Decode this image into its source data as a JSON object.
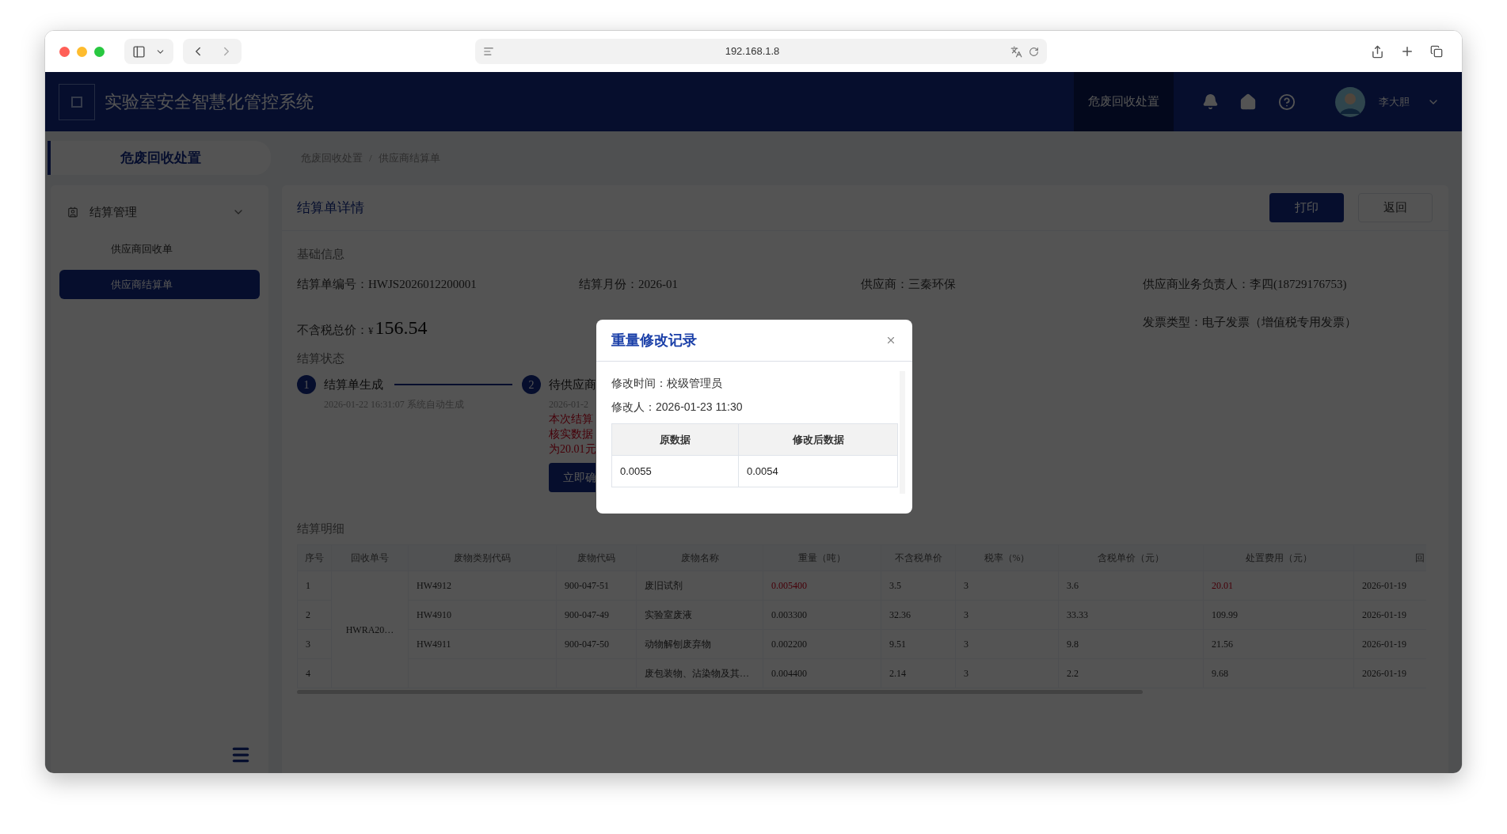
{
  "browser": {
    "url": "192.168.1.8"
  },
  "app": {
    "title": "实验室安全智慧化管控系统",
    "nav": [
      {
        "label": "危废回收处置",
        "selected": true
      }
    ],
    "user": {
      "name": "李大胆"
    }
  },
  "sidebar": {
    "section_title": "危废回收处置",
    "groups": [
      {
        "label": "结算管理",
        "expanded": true,
        "children": [
          {
            "label": "供应商回收单",
            "selected": false
          },
          {
            "label": "供应商结算单",
            "selected": true
          }
        ]
      }
    ]
  },
  "breadcrumb": {
    "items": [
      "危废回收处置",
      "供应商结算单"
    ],
    "separator": "/"
  },
  "card": {
    "title": "结算单详情",
    "buttons": [
      {
        "label": "打印",
        "kind": "primary"
      },
      {
        "label": "返回",
        "kind": "default"
      }
    ],
    "basic_info": {
      "heading": "基础信息",
      "fields": [
        {
          "label": "结算单编号：",
          "value": "HWJS2026012200001",
          "kind": "text"
        },
        {
          "label": "结算月份：",
          "value": "2026-01",
          "kind": "text"
        },
        {
          "label": "供应商：",
          "value": "三秦环保",
          "kind": "text"
        },
        {
          "label": "供应商业务负责人：",
          "value": "李四(18729176753)",
          "kind": "text"
        },
        {
          "label": "不含税总价：",
          "currency": "¥",
          "value": "156.54",
          "kind": "amount"
        },
        {
          "label": "发票类型：",
          "value": "电子发票（增值税专用发票）",
          "kind": "text"
        }
      ]
    },
    "status": {
      "heading": "结算状态",
      "steps": [
        {
          "number": "1",
          "title": "结算单生成",
          "time": "2026-01-22 16:31:07 系统自动生成"
        },
        {
          "number": "2",
          "title": "待供应商",
          "time": "2026-01-2",
          "notes": [
            "本次结算",
            "核实数据",
            "为20.01元"
          ],
          "action": "立即确"
        }
      ]
    },
    "details": {
      "heading": "结算明细",
      "table": {
        "columns": [
          "序号",
          "回收单号",
          "废物类别代码",
          "废物代码",
          "废物名称",
          "重量（吨）",
          "不含税单价",
          "税率（%）",
          "含税单价（元）",
          "处置费用（元）",
          "回"
        ],
        "merged_recovery_order": "HWRA20…",
        "rows": [
          {
            "no": "1",
            "category_code": "HW4912",
            "waste_code": "900-047-51",
            "name": "废旧试剂",
            "weight": "0.005400",
            "price_ex_tax": "3.5",
            "tax_rate": "3",
            "price_inc_tax": "3.6",
            "fee": "20.01",
            "column_11": "2026-01-19",
            "modified": true
          },
          {
            "no": "2",
            "category_code": "HW4910",
            "waste_code": "900-047-49",
            "name": "实验室废液",
            "weight": "0.003300",
            "price_ex_tax": "32.36",
            "tax_rate": "3",
            "price_inc_tax": "33.33",
            "fee": "109.99",
            "column_11": "2026-01-19",
            "modified": false
          },
          {
            "no": "3",
            "category_code": "HW4911",
            "waste_code": "900-047-50",
            "name": "动物解刨废弃物",
            "weight": "0.002200",
            "price_ex_tax": "9.51",
            "tax_rate": "3",
            "price_inc_tax": "9.8",
            "fee": "21.56",
            "column_11": "2026-01-19",
            "modified": false
          },
          {
            "no": "4",
            "name": "废包装物、沾染物及其…",
            "weight": "0.004400",
            "price_ex_tax": "2.14",
            "tax_rate": "3",
            "price_inc_tax": "2.2",
            "fee": "9.68",
            "column_11": "2026-01-19",
            "modified": false
          }
        ]
      }
    }
  },
  "dialog": {
    "title": "重量修改记录",
    "fields": [
      {
        "label": "修改时间：",
        "value": "校级管理员"
      },
      {
        "label": "修改人：",
        "value": "2026-01-23 11:30"
      }
    ],
    "table": {
      "columns": [
        "原数据",
        "修改后数据"
      ],
      "rows": [
        [
          "0.0055",
          "0.0054"
        ]
      ]
    }
  }
}
